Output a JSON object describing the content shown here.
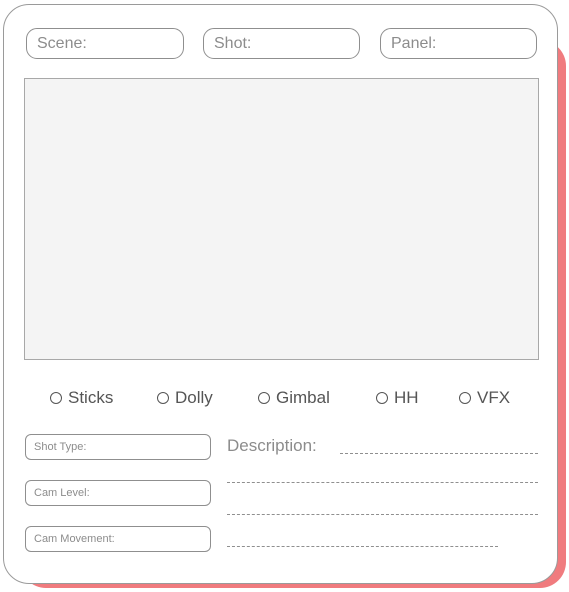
{
  "header": {
    "scene_label": "Scene:",
    "shot_label": "Shot:",
    "panel_label": "Panel:"
  },
  "options": [
    {
      "label": "Sticks"
    },
    {
      "label": "Dolly"
    },
    {
      "label": "Gimbal"
    },
    {
      "label": "HH"
    },
    {
      "label": "VFX"
    }
  ],
  "fields": {
    "shot_type": "Shot Type:",
    "cam_level": "Cam Level:",
    "cam_movement": "Cam Movement:"
  },
  "description": {
    "label": "Description:"
  },
  "colors": {
    "accent_shadow": "#f07b7e",
    "border": "#9a9a9a",
    "panel_bg": "#f4f4f4"
  }
}
